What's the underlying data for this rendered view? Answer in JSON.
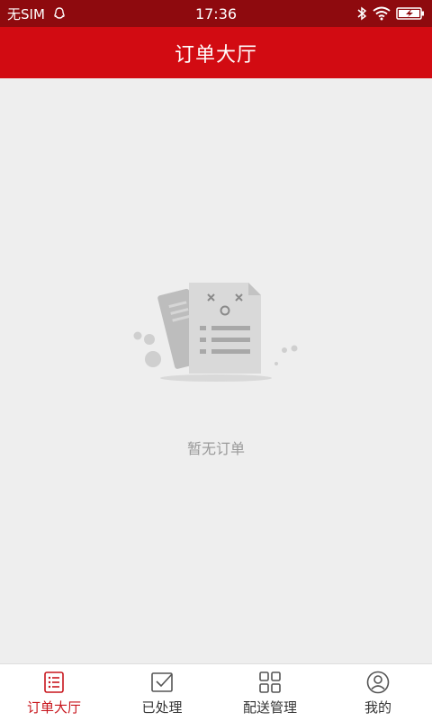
{
  "status_bar": {
    "carrier": "无SIM",
    "time": "17:36",
    "icons": [
      "qq-icon",
      "bluetooth-icon",
      "wifi-icon",
      "battery-icon"
    ]
  },
  "header": {
    "title": "订单大厅"
  },
  "main": {
    "empty_message": "暂无订单",
    "illustration": "empty-order-icon"
  },
  "bottom_nav": {
    "items": [
      {
        "label": "订单大厅",
        "icon": "order-list-icon",
        "active": true
      },
      {
        "label": "已处理",
        "icon": "processed-icon",
        "active": false
      },
      {
        "label": "配送管理",
        "icon": "grid-icon",
        "active": false
      },
      {
        "label": "我的",
        "icon": "user-icon",
        "active": false
      }
    ]
  },
  "colors": {
    "status_bar": "#8e0a0e",
    "header": "#d20b12",
    "background": "#eeeeee",
    "active_tab": "#c8161d",
    "inactive_tab": "#333333",
    "empty_text": "#9a9a9a"
  }
}
